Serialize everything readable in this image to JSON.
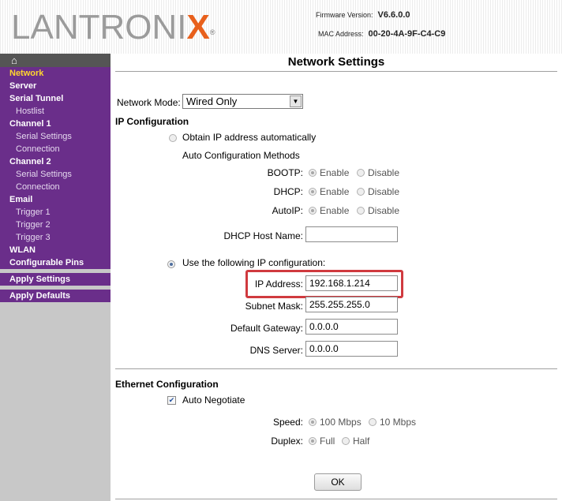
{
  "header": {
    "logo": "LANTRONIX",
    "firmware_label": "Firmware Version:",
    "firmware_value": "V6.6.0.0",
    "mac_label": "MAC Address:",
    "mac_value": "00-20-4A-9F-C4-C9"
  },
  "page_title": "Network Settings",
  "sidebar": {
    "home_icon": "home-icon",
    "items": [
      {
        "label": "Network",
        "kind": "main",
        "selected": true
      },
      {
        "label": "Server",
        "kind": "main"
      },
      {
        "label": "Serial Tunnel",
        "kind": "main"
      },
      {
        "label": "Hostlist",
        "kind": "sub"
      },
      {
        "label": "Channel 1",
        "kind": "main"
      },
      {
        "label": "Serial Settings",
        "kind": "sub"
      },
      {
        "label": "Connection",
        "kind": "sub"
      },
      {
        "label": "Channel 2",
        "kind": "main"
      },
      {
        "label": "Serial Settings",
        "kind": "sub"
      },
      {
        "label": "Connection",
        "kind": "sub"
      },
      {
        "label": "Email",
        "kind": "main"
      },
      {
        "label": "Trigger 1",
        "kind": "sub"
      },
      {
        "label": "Trigger 2",
        "kind": "sub"
      },
      {
        "label": "Trigger 3",
        "kind": "sub"
      },
      {
        "label": "WLAN",
        "kind": "main"
      },
      {
        "label": "Configurable Pins",
        "kind": "main"
      },
      {
        "label": "Apply Settings",
        "kind": "main"
      },
      {
        "label": "Apply Defaults",
        "kind": "main"
      }
    ]
  },
  "form": {
    "network_mode_label": "Network Mode:",
    "network_mode_value": "Wired Only",
    "ip_config_heading": "IP Configuration",
    "obtain_auto_label": "Obtain IP address automatically",
    "auto_methods_label": "Auto Configuration Methods",
    "bootp_label": "BOOTP:",
    "dhcp_label": "DHCP:",
    "autoip_label": "AutoIP:",
    "enable_label": "Enable",
    "disable_label": "Disable",
    "dhcp_host_label": "DHCP Host Name:",
    "dhcp_host_value": "",
    "use_following_label": "Use the following IP configuration:",
    "ip_label": "IP Address:",
    "ip_value": "192.168.1.214",
    "subnet_label": "Subnet Mask:",
    "subnet_value": "255.255.255.0",
    "gateway_label": "Default Gateway:",
    "gateway_value": "0.0.0.0",
    "dns_label": "DNS Server:",
    "dns_value": "0.0.0.0",
    "ethernet_heading": "Ethernet Configuration",
    "auto_negotiate_label": "Auto Negotiate",
    "speed_label": "Speed:",
    "speed_100": "100 Mbps",
    "speed_10": "10 Mbps",
    "duplex_label": "Duplex:",
    "duplex_full": "Full",
    "duplex_half": "Half",
    "ok_label": "OK"
  },
  "colors": {
    "sidebar_purple": "#6a2e8a",
    "selected_nav_text": "#ffd52e",
    "highlight_red": "#d03a3f",
    "logo_orange": "#e8601c"
  }
}
